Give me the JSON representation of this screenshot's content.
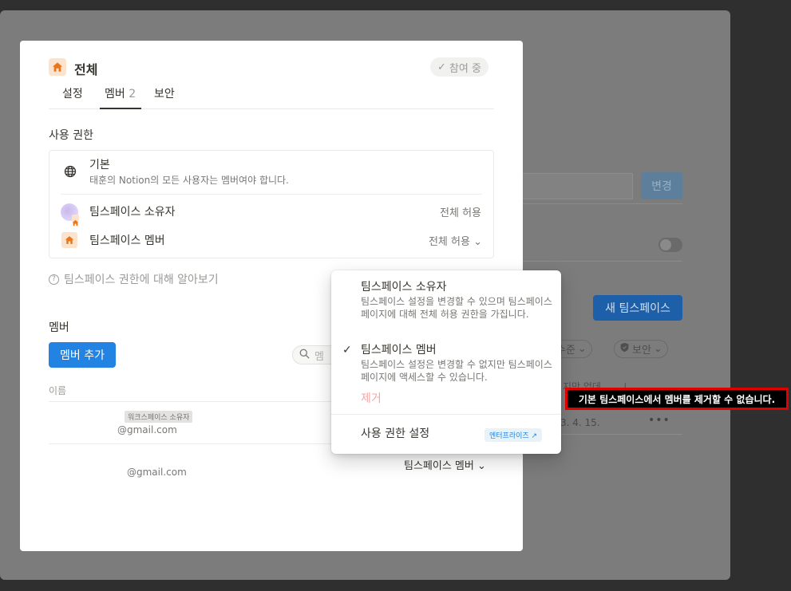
{
  "background": {
    "change_button": "변경",
    "new_teamspace_button": "새 팀스페이스",
    "filter_level": "수준",
    "filter_security": "보안",
    "column_last_updated": "지막 업데...",
    "row_date": "3. 4. 15.",
    "row_more": "•••"
  },
  "modal": {
    "workspace_title": "전체",
    "joined_badge": "참여 중",
    "tabs": [
      {
        "label": "설정"
      },
      {
        "label": "멤버",
        "count": "2"
      },
      {
        "label": "보안"
      }
    ],
    "access_section_label": "사용 권한",
    "permissions": {
      "default_title": "기본",
      "default_desc": "태훈의 Notion의 모든 사용자는 멤버여야 합니다.",
      "owner_title": "팀스페이스 소유자",
      "owner_access": "전체 허용",
      "member_title": "팀스페이스 멤버",
      "member_access": "전체 허용"
    },
    "help_link": "팀스페이스 권한에 대해 알아보기",
    "members_section_label": "멤버",
    "add_member_button": "멤버 추가",
    "search_placeholder": "멤",
    "column_name": "이름",
    "members": [
      {
        "tag": "워크스페이스 소유자",
        "email": "@gmail.com"
      },
      {
        "email": "@gmail.com",
        "role": "팀스페이스 멤버"
      }
    ]
  },
  "dropdown": {
    "owner_title": "팀스페이스 소유자",
    "owner_desc": "팀스페이스 설정을 변경할 수 있으며 팀스페이스 페이지에 대해 전체 허용 권한을 가집니다.",
    "member_title": "팀스페이스 멤버",
    "member_desc": "팀스페이스 설정은 변경할 수 없지만 팀스페이스 페이지에 액세스할 수 있습니다.",
    "remove": "제거",
    "access_settings": "사용 권한 설정",
    "enterprise_badge": "엔터프라이즈 ↗"
  },
  "tooltip": "기본 팀스페이스에서 멤버를 제거할 수 없습니다.",
  "colors": {
    "accent": "#2383e2",
    "workspace_icon": "#e8771b",
    "tooltip_border": "#e00000"
  }
}
